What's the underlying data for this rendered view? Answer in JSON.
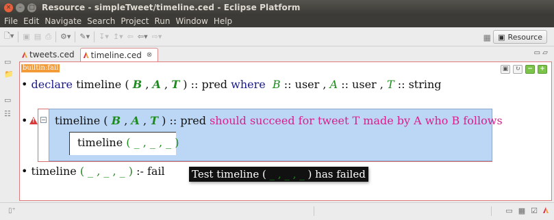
{
  "window": {
    "title": "Resource - simpleTweet/timeline.ced - Eclipse Platform"
  },
  "menu": [
    "File",
    "Edit",
    "Navigate",
    "Search",
    "Project",
    "Run",
    "Window",
    "Help"
  ],
  "toolbar": {
    "perspective_label": "Resource"
  },
  "editor": {
    "tabs": [
      {
        "label": "tweets.ced",
        "active": false
      },
      {
        "label": "timeline.ced",
        "active": true,
        "close": "⊗"
      }
    ],
    "status_label": "builtin:fail",
    "line1": {
      "bullet": "•",
      "kw_declare": "declare",
      "name": "timeline",
      "open": "(",
      "B": "B",
      "comma1": ",",
      "A": "A",
      "comma2": ",",
      "T": "T",
      "close": ")",
      "pred": ":: pred",
      "kw_where": "where",
      "Bv": "B",
      "Btype": ":: user ,",
      "Av": "A",
      "Atype": ":: user ,",
      "Tv": "T",
      "Ttype": ":: string"
    },
    "test": {
      "head_name": "timeline",
      "open": "(",
      "B": "B",
      "comma1": ",",
      "A": "A",
      "comma2": ",",
      "T": "T",
      "close": ")",
      "pred": ":: pred",
      "description": "should succeed for tweet T made by A who B follows",
      "call_name": "timeline",
      "call_args": "( _ , _ , _ )",
      "fold_glyph": "−",
      "warn_glyph": "!"
    },
    "line3": {
      "bullet": "•",
      "name": "timeline",
      "args": "( _ , _ , _ )",
      "rule": ":- fail"
    },
    "tooltip": {
      "prefix": "Test timeline (",
      "args": " _ , _ , _ ",
      "suffix": ") has failed"
    }
  }
}
